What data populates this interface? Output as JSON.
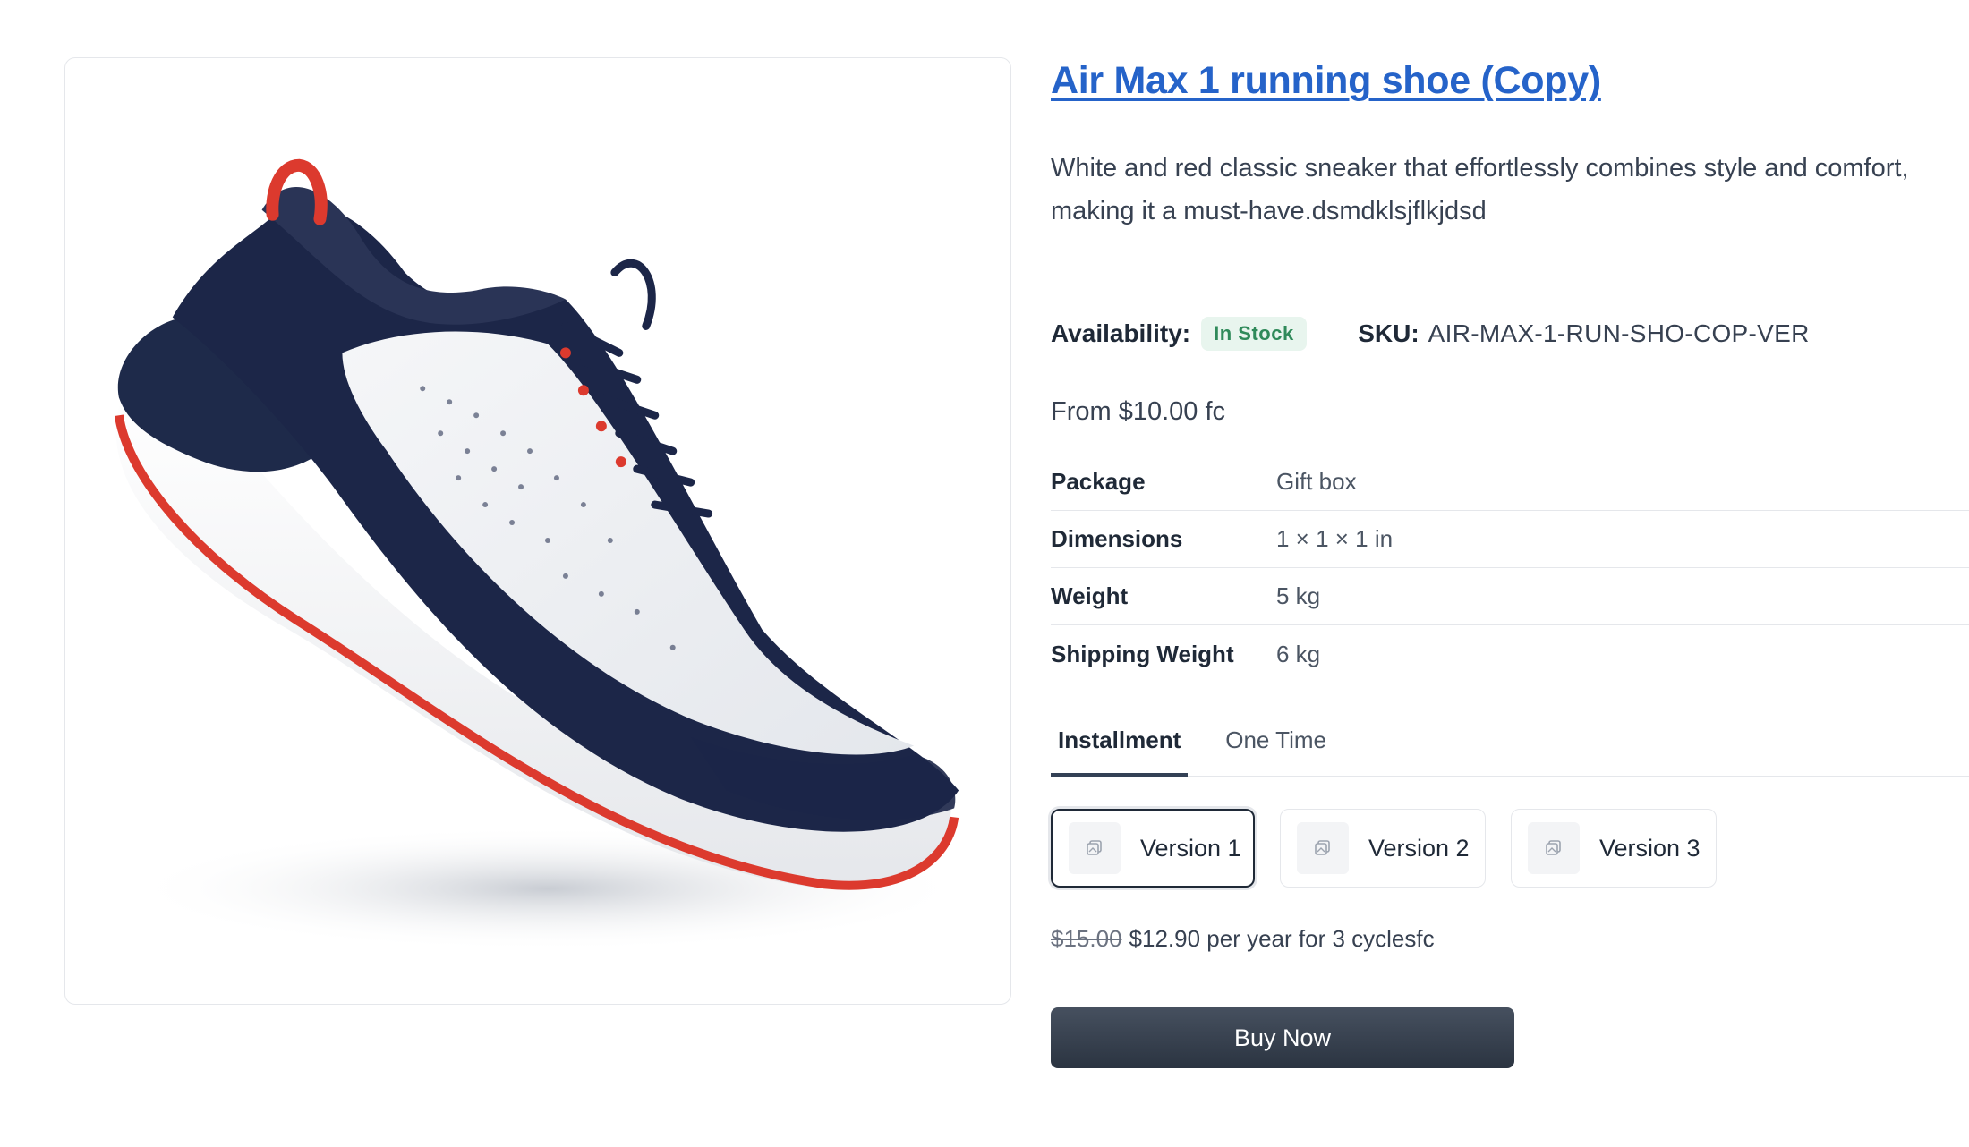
{
  "product": {
    "title": "Air Max 1 running shoe (Copy)",
    "description": "White and red classic sneaker that effortlessly combines style and comfort, making it a must-have.dsmdklsjflkjdsd",
    "image_alt": "running-shoe-image"
  },
  "availability": {
    "label": "Availability:",
    "status": "In Stock",
    "status_color": "#2f8a5a"
  },
  "sku": {
    "label": "SKU:",
    "value": "AIR-MAX-1-RUN-SHO-COP-VER"
  },
  "price_from": "From $10.00 fc",
  "specs": [
    {
      "label": "Package",
      "value": "Gift box"
    },
    {
      "label": "Dimensions",
      "value": "1 × 1 × 1 in"
    },
    {
      "label": "Weight",
      "value": "5 kg"
    },
    {
      "label": "Shipping Weight",
      "value": "6 kg"
    }
  ],
  "tabs": [
    {
      "label": "Installment",
      "active": true
    },
    {
      "label": "One Time",
      "active": false
    }
  ],
  "versions": [
    {
      "label": "Version 1",
      "selected": true,
      "icon": "image-placeholder-icon"
    },
    {
      "label": "Version 2",
      "selected": false,
      "icon": "image-placeholder-icon"
    },
    {
      "label": "Version 3",
      "selected": false,
      "icon": "image-placeholder-icon"
    }
  ],
  "pricing": {
    "original": "$15.00",
    "current": "$12.90 per year for 3 cyclesfc"
  },
  "buy_button": "Buy Now",
  "colors": {
    "title_link": "#2563c9",
    "button_bg": "#2b3441",
    "badge_bg": "#e8f5ee"
  }
}
